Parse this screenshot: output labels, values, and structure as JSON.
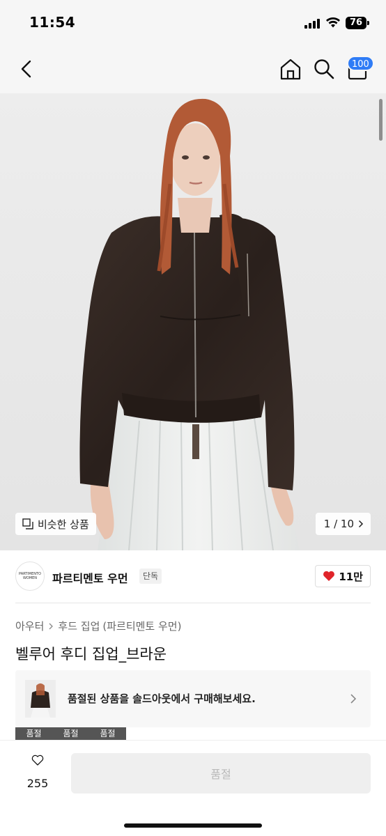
{
  "status_bar": {
    "time": "11:54",
    "battery": "76",
    "icons": [
      "signal-icon",
      "wifi-icon",
      "battery-icon"
    ]
  },
  "nav": {
    "icons": [
      "back-chevron-icon",
      "home-icon",
      "search-icon",
      "cart-icon"
    ],
    "cart_badge": "100",
    "accent_color": "#2f7cf6"
  },
  "gallery": {
    "similar_label": "비슷한 상품",
    "counter": "1 / 10"
  },
  "brand": {
    "logo_text_line1": "PARTIMENTO",
    "logo_text_line2": "WOMEN",
    "name": "파르티멘토 우먼",
    "tag": "단독",
    "likes": "11만",
    "heart_color": "#e0242a"
  },
  "product": {
    "breadcrumb": [
      "아우터",
      "후드 집업",
      "(파르티멘토 우먼)"
    ],
    "title": "벨루어 후디 집업_브라운"
  },
  "soldout_banner": {
    "text": "품절된 상품을 솔드아웃에서 구매해보세요."
  },
  "soldout_labels": [
    "품절",
    "품절",
    "품절"
  ],
  "bottom_bar": {
    "wish_count": "255",
    "buy_label": "품절"
  }
}
